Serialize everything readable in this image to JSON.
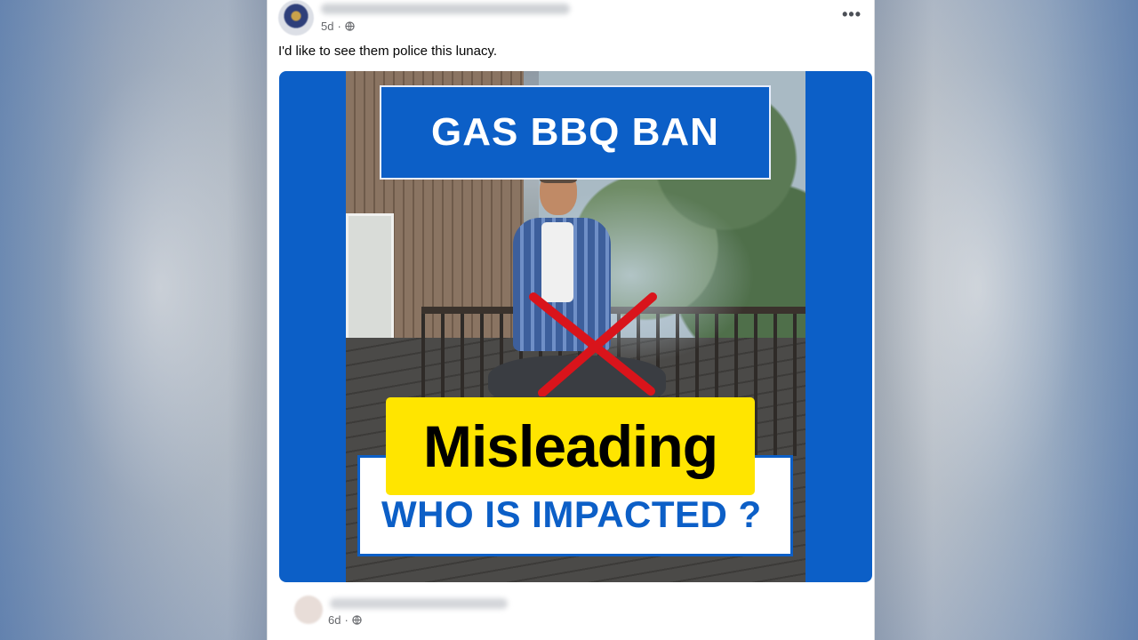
{
  "post": {
    "time": "5d",
    "separator": "·",
    "privacy_icon": "globe-icon",
    "more_icon": "more-options-icon",
    "more_label": "•••",
    "caption": "I'd like to see them police this lunacy."
  },
  "image": {
    "headline": "GAS BBQ BAN",
    "bottom_text": "WHO IS IMPACTED ?",
    "verdict_label": "Misleading",
    "x_mark_icon": "red-x-icon"
  },
  "comment": {
    "time": "6d",
    "separator": "·",
    "privacy_icon": "globe-icon"
  },
  "colors": {
    "brand_blue": "#0c5fc7",
    "verdict_yellow": "#ffe500",
    "x_red": "#d9141b"
  }
}
